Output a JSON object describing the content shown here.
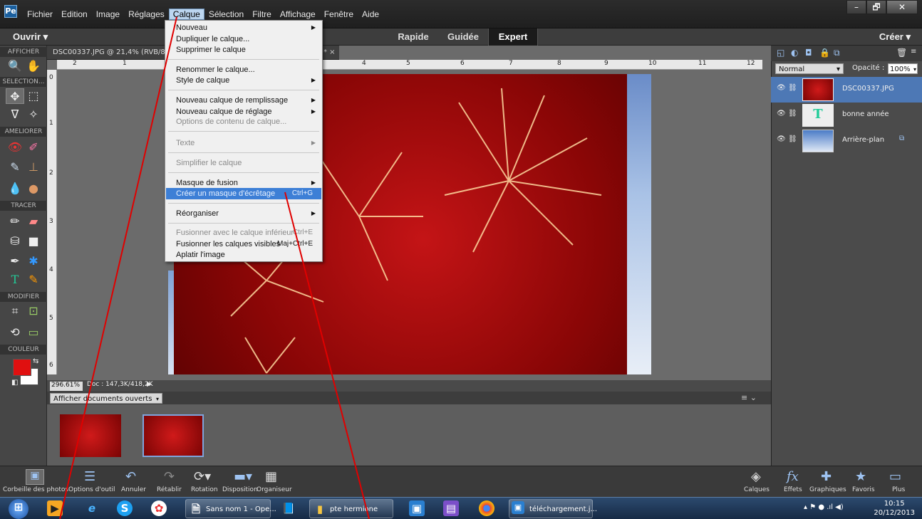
{
  "menubar": {
    "items": [
      "Fichier",
      "Edition",
      "Image",
      "Réglages",
      "Calque",
      "Sélection",
      "Filtre",
      "Affichage",
      "Fenêtre",
      "Aide"
    ],
    "active": "Calque",
    "window_controls": [
      "–",
      "🗗",
      "✕"
    ]
  },
  "modebar": {
    "open_label": "Ouvrir  ▾",
    "modes": [
      "Rapide",
      "Guidée",
      "Expert"
    ],
    "selected_mode": "Expert",
    "create_label": "Créer  ▾"
  },
  "document": {
    "tab_title": "DSC00337.JPG @ 21,4% (RVB/8) *",
    "second_tab_close": "* ×",
    "zoom": "296.61%",
    "doc_size": "Doc : 147,3K/418,2K",
    "ruler_h": [
      "2",
      "1",
      "4",
      "5",
      "6",
      "7",
      "8",
      "9",
      "10",
      "11",
      "12"
    ],
    "ruler_v": [
      "0",
      "1",
      "2",
      "3",
      "4",
      "5",
      "6"
    ]
  },
  "layer_menu": {
    "items": [
      {
        "label": "Nouveau",
        "submenu": true,
        "disabled": false
      },
      {
        "label": "Dupliquer le calque...",
        "submenu": false,
        "disabled": false
      },
      {
        "label": "Supprimer le calque",
        "submenu": false,
        "disabled": false
      },
      {
        "label": "Renommer le calque...",
        "submenu": false,
        "disabled": false
      },
      {
        "label": "Style de calque",
        "submenu": true,
        "disabled": false
      },
      {
        "label": "Nouveau calque de remplissage",
        "submenu": true,
        "disabled": false
      },
      {
        "label": "Nouveau calque de réglage",
        "submenu": true,
        "disabled": false
      },
      {
        "label": "Options de contenu de calque...",
        "submenu": false,
        "disabled": true
      },
      {
        "label": "Texte",
        "submenu": true,
        "disabled": true
      },
      {
        "label": "Simplifier le calque",
        "submenu": false,
        "disabled": true
      },
      {
        "label": "Masque de fusion",
        "submenu": true,
        "disabled": false
      },
      {
        "label": "Créer un masque d'écrêtage",
        "shortcut": "Ctrl+G",
        "highlighted": true,
        "disabled": false
      },
      {
        "label": "Réorganiser",
        "submenu": true,
        "disabled": false
      },
      {
        "label": "Fusionner avec le calque inférieur",
        "shortcut": "Ctrl+E",
        "disabled": true
      },
      {
        "label": "Fusionner les calques visibles",
        "shortcut": "Maj+Ctrl+E",
        "disabled": false
      },
      {
        "label": "Aplatir l'image",
        "disabled": false
      }
    ]
  },
  "toolbox": {
    "sections": [
      "AFFICHER",
      "SELECTION...",
      "AMELIORER",
      "TRACER",
      "MODIFIER",
      "COULEUR"
    ],
    "foreground_color": "#e01010",
    "background_color": "#ffffff"
  },
  "project_bin": {
    "dropdown": "Afficher documents ouverts"
  },
  "layers_panel": {
    "blend_mode": "Normal",
    "opacity_label": "Opacité :",
    "opacity_value": "100%",
    "layers": [
      {
        "name": "DSC00337.JPG",
        "selected": true
      },
      {
        "name": "bonne année",
        "type_icon": "T"
      },
      {
        "name": "Arrière-plan"
      }
    ]
  },
  "bottom_bar": {
    "left": [
      "Corbeille des photos",
      "Options d'outil",
      "Annuler",
      "Rétablir",
      "Rotation",
      "Disposition",
      "Organiseur"
    ],
    "right": [
      "Calques",
      "Effets",
      "Graphiques",
      "Favoris",
      "Plus"
    ]
  },
  "taskbar": {
    "apps": [
      "Sans nom 1 - Ope...",
      "pte hermione",
      "téléchargement.j..."
    ],
    "time": "10:15",
    "date": "20/12/2013"
  },
  "colors": {
    "menu_highlight": "#3d7fd6",
    "layer_selected": "#4d78b5",
    "annotation": "#e00000"
  }
}
